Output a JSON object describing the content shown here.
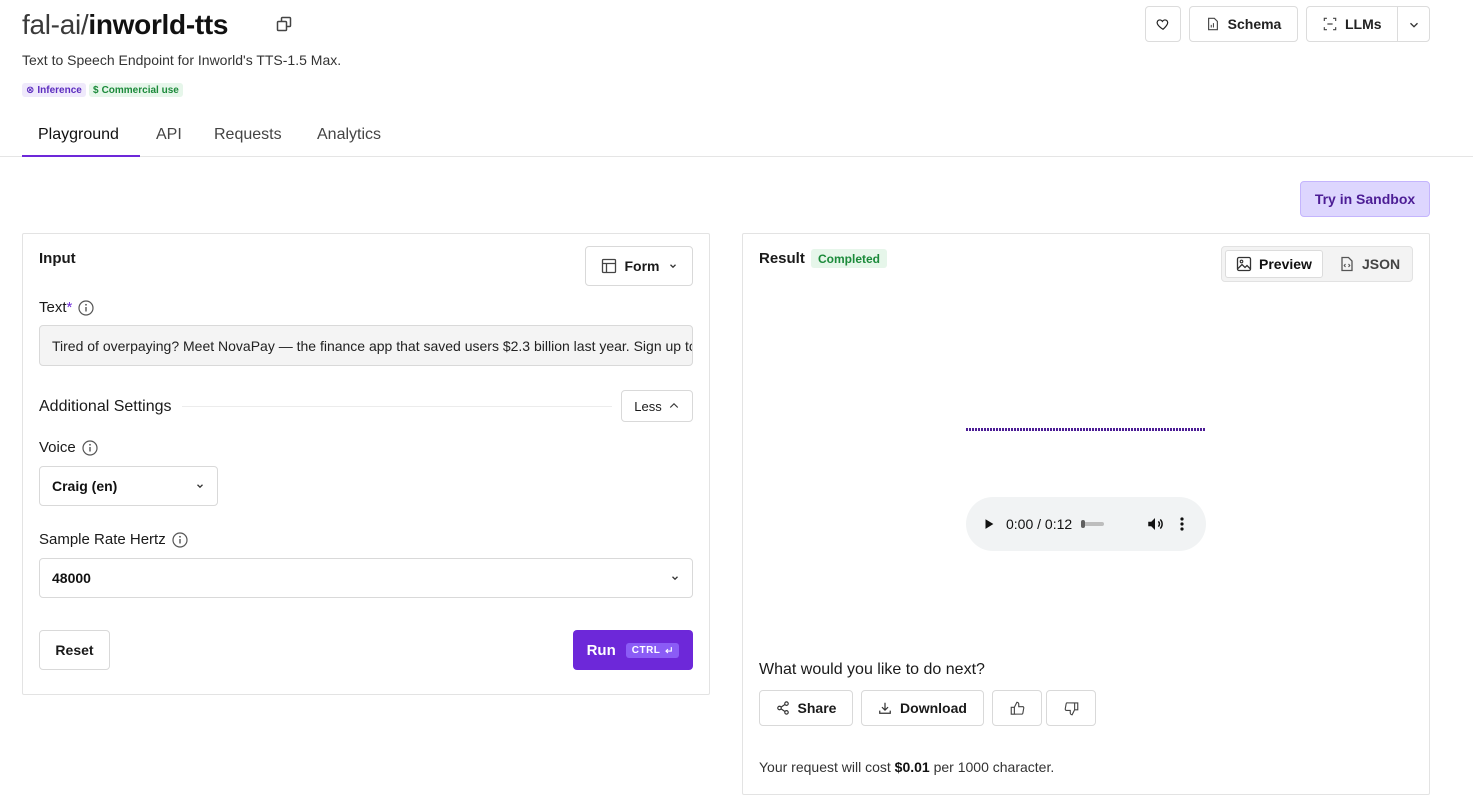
{
  "header": {
    "org": "fal-ai/",
    "model": "inworld-tts",
    "subtitle": "Text to Speech Endpoint for Inworld's TTS-1.5 Max.",
    "badges": {
      "inference": "Inference",
      "commercial": "Commercial use"
    },
    "actions": {
      "schema": "Schema",
      "llms": "LLMs"
    }
  },
  "tabs": [
    "Playground",
    "API",
    "Requests",
    "Analytics"
  ],
  "sandbox_label": "Try in Sandbox",
  "input": {
    "title": "Input",
    "mode_label": "Form",
    "text_label": "Text",
    "text_required_mark": "*",
    "text_value": "Tired of overpaying? Meet NovaPay — the finance app that saved users $2.3 billion last year. Sign up today and start saving.",
    "additional_settings": "Additional Settings",
    "less_label": "Less",
    "voice_label": "Voice",
    "voice_value": "Craig (en)",
    "sample_rate_label": "Sample Rate Hertz",
    "sample_rate_value": "48000",
    "reset_label": "Reset",
    "run_label": "Run",
    "run_shortcut": "CTRL"
  },
  "result": {
    "title": "Result",
    "status": "Completed",
    "preview_label": "Preview",
    "json_label": "JSON",
    "audio_time": "0:00 / 0:12",
    "audio_progress": 0.0,
    "next_question": "What would you like to do next?",
    "share_label": "Share",
    "download_label": "Download",
    "cost_prefix": "Your request will cost ",
    "cost_amount": "$0.01",
    "cost_suffix": " per 1000 character."
  },
  "colors": {
    "accent": "#6d28d9",
    "sandbox_bg": "#ddd6fe",
    "success": "#1b8a3a"
  }
}
